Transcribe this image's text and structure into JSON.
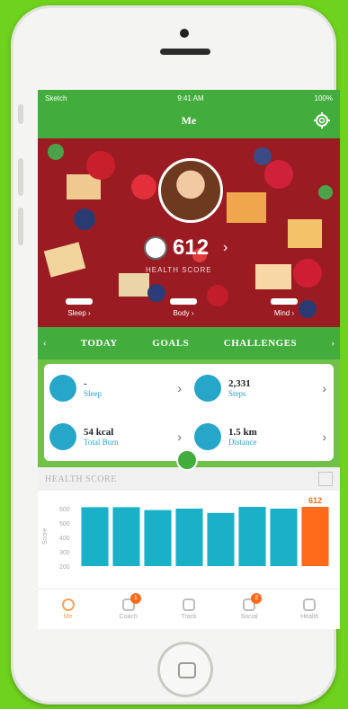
{
  "status": {
    "carrier": "Sketch",
    "time": "9:41 AM",
    "battery": "100%"
  },
  "nav": {
    "title": "Me"
  },
  "hero": {
    "score": "612",
    "score_label": "HEALTH SCORE",
    "minis": [
      {
        "label": "Sleep"
      },
      {
        "label": "Body"
      },
      {
        "label": "Mind"
      }
    ]
  },
  "tabs": {
    "items": [
      "TODAY",
      "GOALS",
      "CHALLENGES"
    ]
  },
  "stats": [
    {
      "value": "-",
      "label": "Sleep"
    },
    {
      "value": "2,331",
      "label": "Steps"
    },
    {
      "value": "54 kcal",
      "label": "Total Burn"
    },
    {
      "value": "1.5 km",
      "label": "Distance"
    }
  ],
  "health_header": {
    "title": "HEALTH SCORE"
  },
  "chart_data": {
    "type": "bar",
    "ylabel": "Score",
    "yticks": [
      "600",
      "500",
      "400",
      "300",
      "200"
    ],
    "ylim": [
      200,
      650
    ],
    "values": [
      610,
      610,
      590,
      600,
      570,
      612,
      600,
      612
    ],
    "highlight_index": 7,
    "highlight_label": "612",
    "colors": {
      "bar": "#1ab0c8",
      "highlight": "#ff6a1a"
    }
  },
  "tabbar": {
    "items": [
      {
        "label": "Me",
        "active": true,
        "badge": ""
      },
      {
        "label": "Coach",
        "active": false,
        "badge": "1"
      },
      {
        "label": "Track",
        "active": false,
        "badge": ""
      },
      {
        "label": "Social",
        "active": false,
        "badge": "2"
      },
      {
        "label": "Health",
        "active": false,
        "badge": ""
      }
    ]
  }
}
